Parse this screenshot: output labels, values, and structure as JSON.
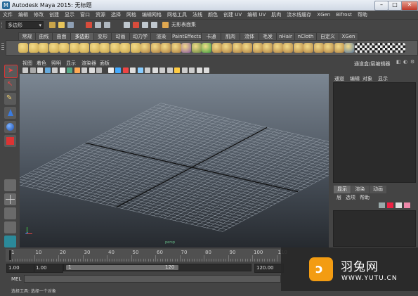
{
  "window": {
    "title": "Autodesk Maya 2015: 无标题",
    "app_icon": "maya-icon",
    "minimize": "–",
    "maximize": "□",
    "close": "✕"
  },
  "menubar": [
    "文件",
    "编辑",
    "修改",
    "创建",
    "显示",
    "窗口",
    "资源",
    "选择",
    "网格",
    "编辑网格",
    "网格工具",
    "法线",
    "颜色",
    "创建 UV",
    "编辑 UV",
    "肌肉",
    "流水线缓存",
    "XGen",
    "Bifrost",
    "帮助"
  ],
  "statusline": {
    "mode": "多边形",
    "no_camera_text": "无影表面集"
  },
  "shelf": {
    "tabs": [
      "常规",
      "曲线",
      "曲面",
      "多边形",
      "变形",
      "动画",
      "动力学",
      "渲染",
      "PaintEffects",
      "卡通",
      "肌肉",
      "流体",
      "毛发",
      "nHair",
      "nCloth",
      "自定义",
      "XGen"
    ],
    "active_tab": "多边形"
  },
  "viewport": {
    "menu": [
      "视图",
      "着色",
      "照明",
      "显示",
      "渲染器",
      "面板"
    ],
    "camera_label": "persp",
    "grid_color": "#9aa3ad",
    "axis_color": "#111111"
  },
  "channel_box": {
    "header": "通道盒/层编辑器",
    "menu": [
      "通道",
      "编辑",
      "对象",
      "显示"
    ]
  },
  "layer_editor": {
    "tabs": [
      "显示",
      "渲染",
      "动画"
    ],
    "active_tab": "显示",
    "menu": [
      "层",
      "选项",
      "帮助"
    ]
  },
  "time_slider": {
    "ticks": [
      "1",
      "10",
      "20",
      "30",
      "40",
      "50",
      "60",
      "70",
      "80",
      "90",
      "100",
      "110"
    ]
  },
  "range_slider": {
    "start": "1.00",
    "anim_start": "1.00",
    "range_start": "1",
    "range_end": "120",
    "end": "120.00"
  },
  "command_line": {
    "label": "MEL"
  },
  "help_line": {
    "text": "选择工具: 选择一个对象"
  },
  "watermark": {
    "name_cn": "羽兔网",
    "url": "WWW.YUTU.CN",
    "logo_glyph": "ɔ",
    "color": "#f39c12"
  }
}
